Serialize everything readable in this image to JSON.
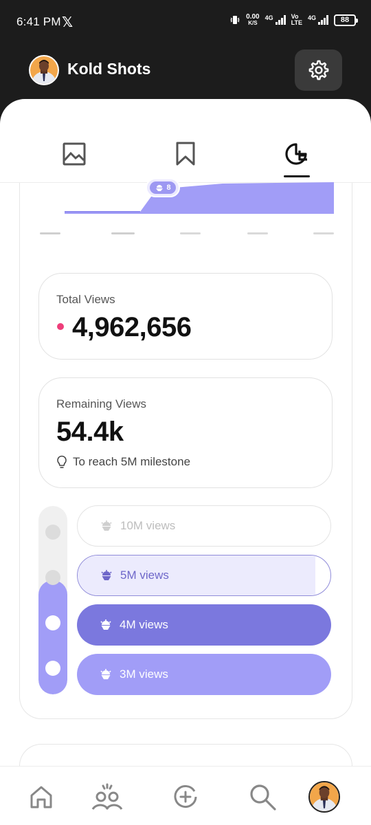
{
  "status_bar": {
    "time": "6:41 PM",
    "x_logo": "𝕏",
    "net_speed_value": "0.00",
    "net_speed_unit": "K/S",
    "sim1_label": "4G",
    "volte_top": "Vo",
    "volte_bottom": "LTE",
    "sim2_label": "4G",
    "battery": "88"
  },
  "header": {
    "username": "Kold Shots"
  },
  "tabs": [
    {
      "name": "gallery",
      "icon": "image-icon",
      "active": false
    },
    {
      "name": "saved",
      "icon": "bookmark-icon",
      "active": false
    },
    {
      "name": "stats",
      "icon": "pie-chart-icon",
      "active": true
    }
  ],
  "chart_badge": {
    "count": "8"
  },
  "total_views": {
    "label": "Total Views",
    "value": "4,962,656"
  },
  "remaining_views": {
    "label": "Remaining Views",
    "value": "54.4k",
    "hint": "To reach 5M milestone"
  },
  "milestones": [
    {
      "label": "10M views",
      "state": "locked"
    },
    {
      "label": "5M views",
      "state": "in-progress",
      "progress": 0.99
    },
    {
      "label": "4M views",
      "state": "reached"
    },
    {
      "label": "3M views",
      "state": "reached"
    }
  ],
  "colors": {
    "accent": "#7b78de",
    "accent_light": "#a19df7",
    "accent_faint": "#ecebfd",
    "dot_pink": "#ee3e7a",
    "header_bg": "#1c1c1c"
  },
  "bottom_nav": [
    {
      "name": "home",
      "icon": "home-icon"
    },
    {
      "name": "community",
      "icon": "people-icon"
    },
    {
      "name": "create",
      "icon": "add-circle-icon"
    },
    {
      "name": "search",
      "icon": "search-icon"
    },
    {
      "name": "profile",
      "icon": "avatar"
    }
  ]
}
